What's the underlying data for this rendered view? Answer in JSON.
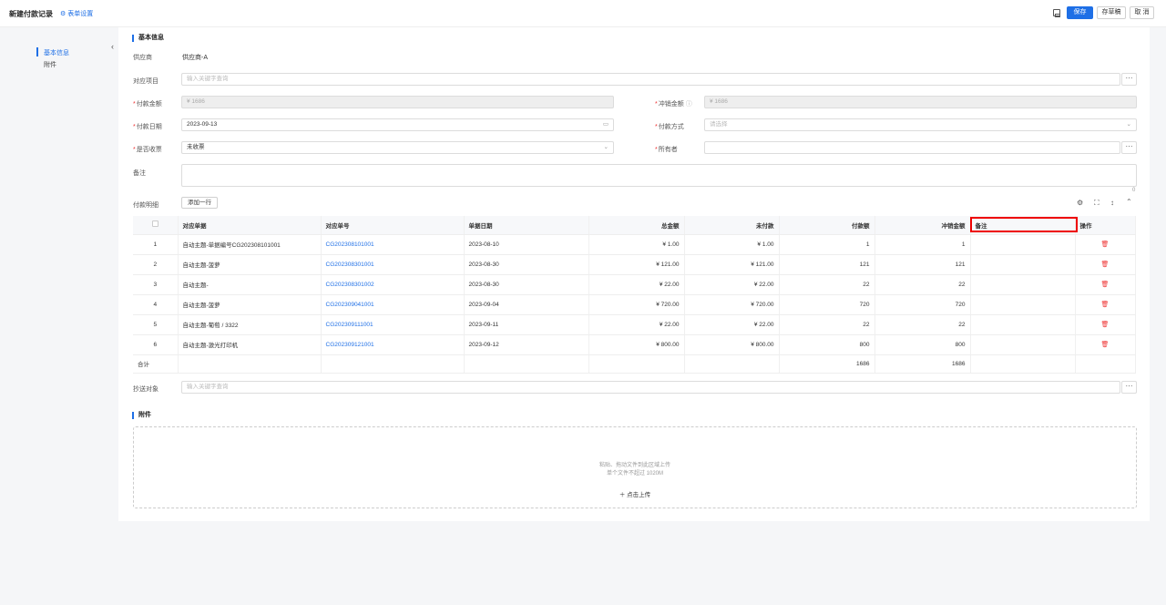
{
  "header": {
    "title": "新建付款记录",
    "form_settings": "表单设置",
    "save": "保存",
    "draft": "存草稿",
    "cancel": "取 消"
  },
  "sidebar": {
    "items": [
      {
        "label": "基本信息"
      },
      {
        "label": "附件"
      }
    ]
  },
  "basic": {
    "section_title": "基本信息",
    "supplier_label": "供应商",
    "supplier_value": "供应商-A",
    "project_label": "对应项目",
    "project_placeholder": "输入关键字查询",
    "amount_label": "付款金额",
    "amount_value": "¥ 1686",
    "offset_label": "冲销金额",
    "offset_value": "¥ 1686",
    "date_label": "付款日期",
    "date_value": "2023-09-13",
    "method_label": "付款方式",
    "method_placeholder": "请选择",
    "invoice_label": "是否收票",
    "invoice_value": "未收票",
    "owner_label": "所有者",
    "remark_label": "备注",
    "remark_count": "0"
  },
  "details": {
    "label": "付款明细",
    "add_row": "添加一行",
    "columns": [
      "对应单据",
      "对应单号",
      "单据日期",
      "总金额",
      "未付款",
      "付款额",
      "冲销金额",
      "备注",
      "操作"
    ],
    "rows": [
      {
        "idx": "1",
        "doc": "自动主题-单据编号CG202308101001",
        "no": "CG202308101001",
        "date": "2023-08-10",
        "total": "¥ 1.00",
        "unpaid": "¥ 1.00",
        "pay": "1",
        "offset": "1"
      },
      {
        "idx": "2",
        "doc": "自动主题-菠萝",
        "no": "CG202308301001",
        "date": "2023-08-30",
        "total": "¥ 121.00",
        "unpaid": "¥ 121.00",
        "pay": "121",
        "offset": "121"
      },
      {
        "idx": "3",
        "doc": "自动主题-",
        "no": "CG202308301002",
        "date": "2023-08-30",
        "total": "¥ 22.00",
        "unpaid": "¥ 22.00",
        "pay": "22",
        "offset": "22"
      },
      {
        "idx": "4",
        "doc": "自动主题-菠萝",
        "no": "CG202309041001",
        "date": "2023-09-04",
        "total": "¥ 720.00",
        "unpaid": "¥ 720.00",
        "pay": "720",
        "offset": "720"
      },
      {
        "idx": "5",
        "doc": "自动主题-葡萄 / 3322",
        "no": "CG202309111001",
        "date": "2023-09-11",
        "total": "¥ 22.00",
        "unpaid": "¥ 22.00",
        "pay": "22",
        "offset": "22"
      },
      {
        "idx": "6",
        "doc": "自动主题-激光打印机",
        "no": "CG202309121001",
        "date": "2023-09-12",
        "total": "¥ 800.00",
        "unpaid": "¥ 800.00",
        "pay": "800",
        "offset": "800"
      }
    ],
    "total_label": "合计",
    "total_pay": "1686",
    "total_offset": "1686"
  },
  "cc": {
    "label": "抄送对象",
    "placeholder": "输入关键字查询"
  },
  "attachments": {
    "section_title": "附件",
    "hint1": "粘贴、拖动文件到此区域上传",
    "hint2": "单个文件不超过 1020M",
    "upload": "点击上传"
  }
}
